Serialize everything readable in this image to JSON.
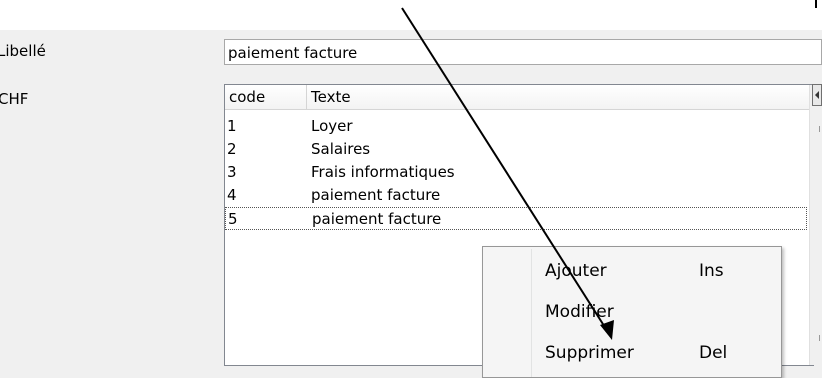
{
  "form": {
    "libelle_label": "Libellé",
    "chf_label": "CHF",
    "combo_value": "paiement facture"
  },
  "grid": {
    "headers": {
      "code": "code",
      "texte": "Texte"
    },
    "rows": [
      {
        "code": "1",
        "texte": "Loyer"
      },
      {
        "code": "2",
        "texte": "Salaires"
      },
      {
        "code": "3",
        "texte": "Frais informatiques"
      },
      {
        "code": "4",
        "texte": "paiement facture"
      },
      {
        "code": "5",
        "texte": "paiement facture"
      }
    ],
    "selected_row_index": 4
  },
  "context_menu": {
    "items": [
      {
        "label": "Ajouter",
        "shortcut": "Ins"
      },
      {
        "label": "Modifier",
        "shortcut": ""
      },
      {
        "label": "Supprimer",
        "shortcut": "Del"
      }
    ]
  },
  "colors": {
    "panel_bg": "#f0f0f0",
    "combo_button": "#bee6fd",
    "arrow": "#000000"
  },
  "icons": {
    "combo_dropdown": "chevron-down-icon",
    "scroll_left": "scroll-left-icon",
    "annotation": "arrow-pointer-icon"
  }
}
